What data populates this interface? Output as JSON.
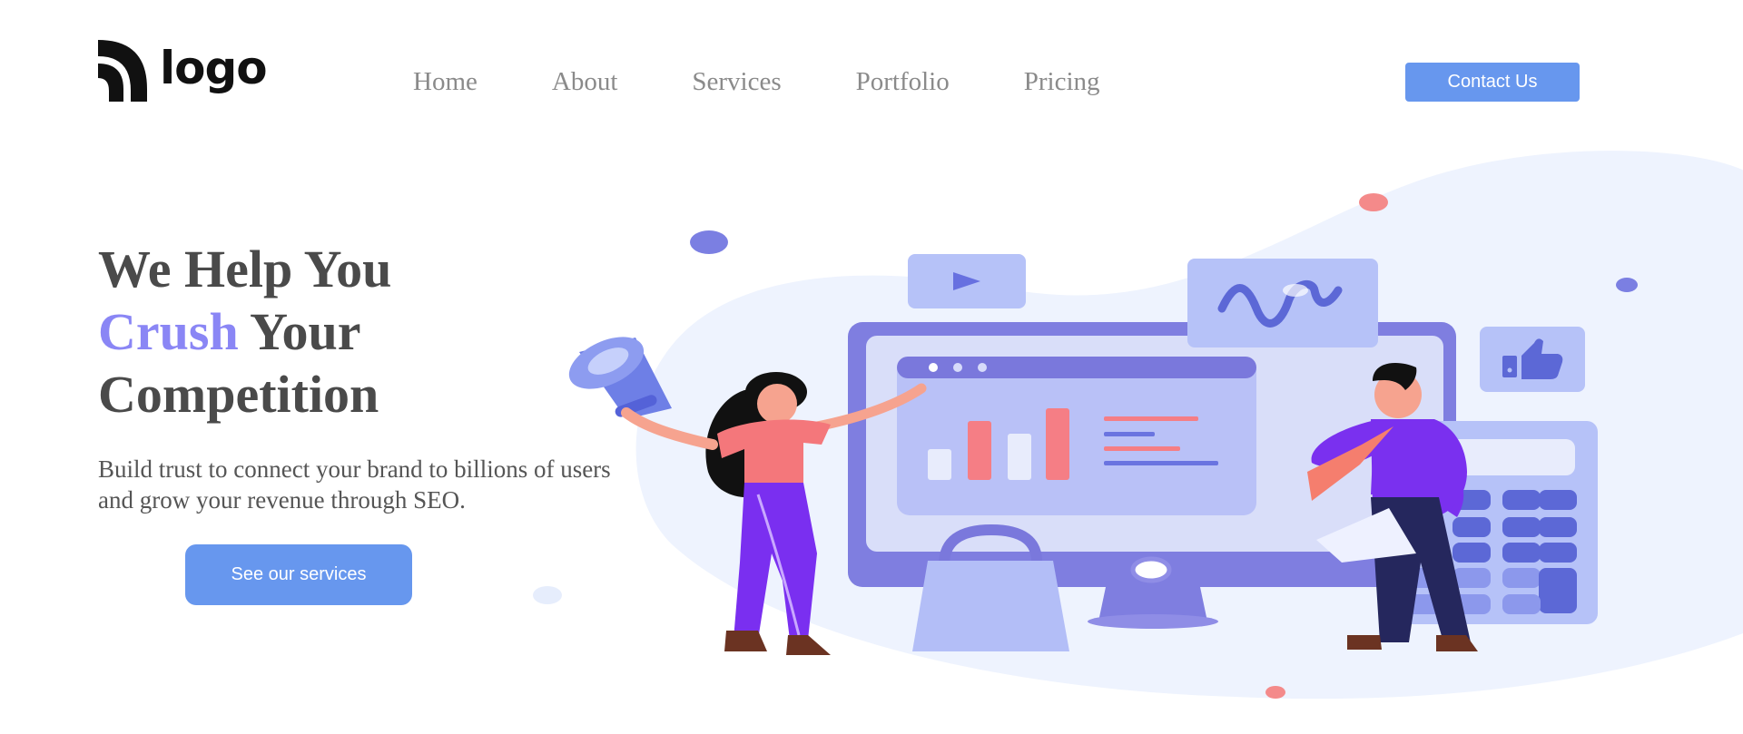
{
  "brand": {
    "logo_text": "logo"
  },
  "nav": {
    "items": [
      {
        "label": "Home"
      },
      {
        "label": "About"
      },
      {
        "label": "Services"
      },
      {
        "label": "Portfolio"
      },
      {
        "label": "Pricing"
      }
    ],
    "contact_label": "Contact Us"
  },
  "hero": {
    "title_line1": "We Help You",
    "title_accent": "Crush",
    "title_line2_rest": " Your",
    "title_line3": "Competition",
    "subtitle": "Build trust to connect your brand to billions of users and grow your revenue through SEO.",
    "cta_label": "See our services"
  },
  "colors": {
    "accent": "#8a86f5",
    "button": "#6797ee",
    "heading": "#4a4a4a",
    "nav_text": "#8a8a8a"
  },
  "icons": [
    "logo-mark-icon",
    "play-icon",
    "wave-chart-icon",
    "thumbs-up-icon",
    "megaphone-icon"
  ]
}
